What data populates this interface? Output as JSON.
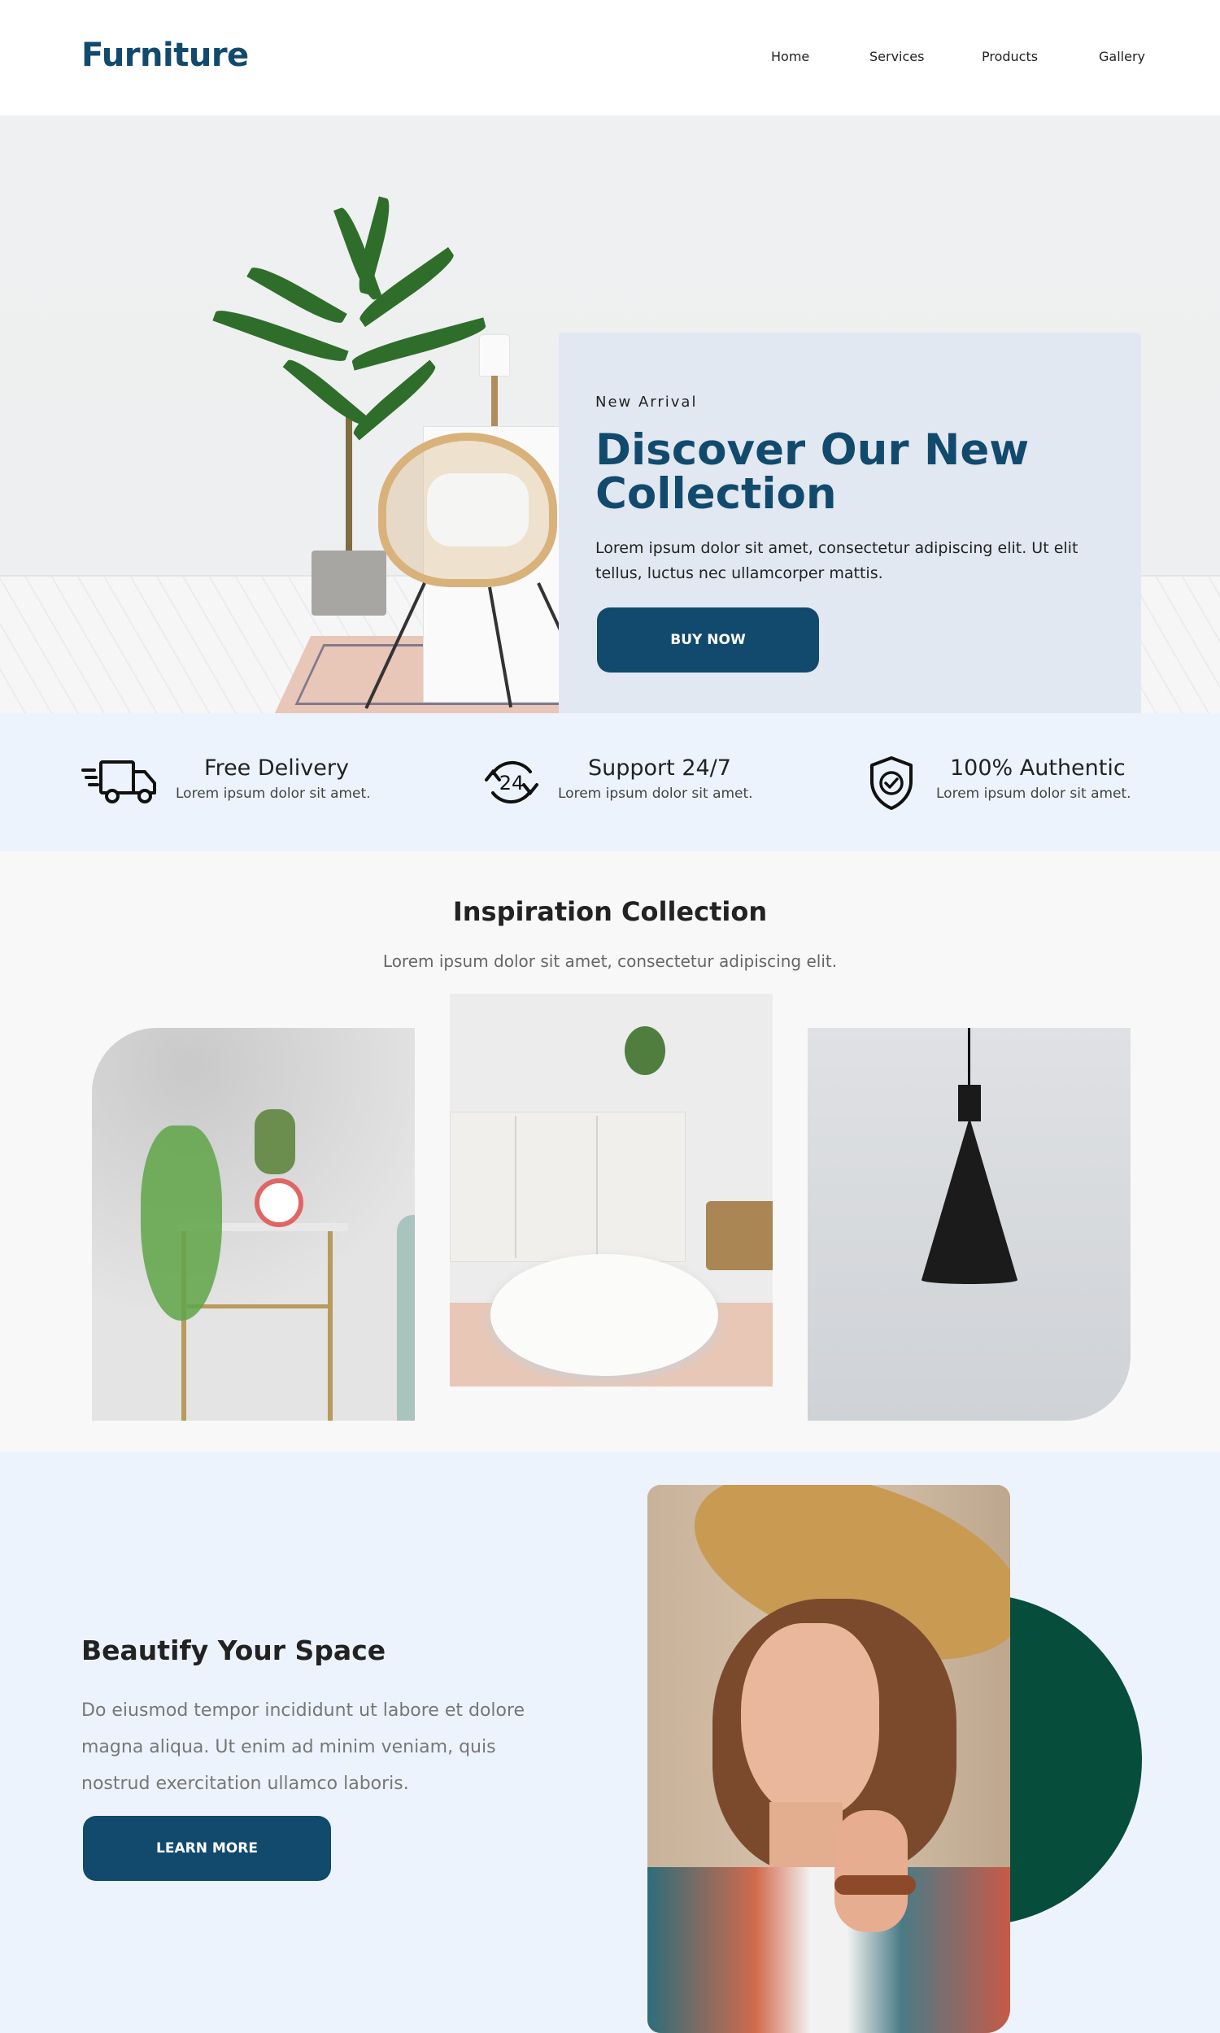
{
  "nav": {
    "logo": "Furniture",
    "items": [
      {
        "label": "Home"
      },
      {
        "label": "Services"
      },
      {
        "label": "Products"
      },
      {
        "label": "Gallery"
      }
    ]
  },
  "hero": {
    "kicker": "New Arrival",
    "title": "Discover Our New Collection",
    "text": "Lorem ipsum dolor sit amet, consectetur adipiscing elit. Ut elit tellus, luctus nec ullamcorper mattis.",
    "button": "BUY NOW"
  },
  "features": [
    {
      "icon": "delivery-truck-icon",
      "title": "Free Delivery",
      "subtitle": "Lorem ipsum dolor sit amet."
    },
    {
      "icon": "support-24-7-icon",
      "title": "Support 24/7",
      "subtitle": "Lorem ipsum dolor sit amet.",
      "icon_text": "24"
    },
    {
      "icon": "shield-check-icon",
      "title": "100% Authentic",
      "subtitle": "Lorem ipsum dolor sit amet."
    }
  ],
  "inspiration": {
    "title": "Inspiration Collection",
    "subtitle": "Lorem ipsum dolor sit amet, consectetur adipiscing elit."
  },
  "beautify": {
    "title": "Beautify Your Space",
    "text": "Do eiusmod tempor incididunt ut labore et dolore magna aliqua. Ut enim ad minim veniam, quis nostrud exercitation ullamco laboris.",
    "button": "LEARN MORE"
  },
  "colors": {
    "brand": "#124a6e",
    "accent_green": "#064e3b",
    "light_blue_bg": "#edf3fc",
    "card_bg": "#e2e8f1"
  }
}
